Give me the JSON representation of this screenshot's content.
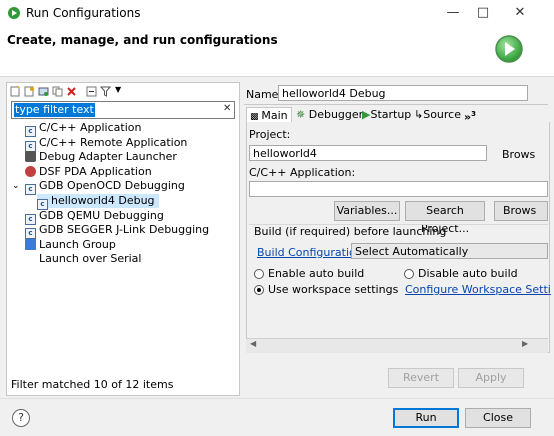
{
  "window": {
    "title": "Run Configurations"
  },
  "header": {
    "title": "Create, manage, and run configurations"
  },
  "left": {
    "filter": {
      "value": "type filter text"
    },
    "tree": [
      {
        "label": "C/C++ Application",
        "icon": "c-config-icon"
      },
      {
        "label": "C/C++ Remote Application",
        "icon": "c-config-icon"
      },
      {
        "label": "Debug Adapter Launcher",
        "icon": "debug-adapter-icon"
      },
      {
        "label": "DSF PDA Application",
        "icon": "pda-icon"
      },
      {
        "label": "GDB OpenOCD Debugging",
        "icon": "c-config-icon"
      },
      {
        "label": "helloworld4 Debug",
        "icon": "c-config-icon"
      },
      {
        "label": "GDB QEMU Debugging",
        "icon": "c-config-icon"
      },
      {
        "label": "GDB SEGGER J-Link Debugging",
        "icon": "c-config-icon"
      },
      {
        "label": "Launch Group",
        "icon": "launch-group-icon"
      },
      {
        "label": "Launch over Serial",
        "icon": ""
      }
    ],
    "status": "Filter matched 10 of 12 items"
  },
  "right": {
    "name_label": "Name:",
    "name_value": "helloworld4 Debug",
    "tabs": [
      {
        "label": "Main"
      },
      {
        "label": "Debugger"
      },
      {
        "label": "Startup"
      },
      {
        "label": "Source"
      },
      {
        "label": "»",
        "count": "3"
      }
    ],
    "project_label": "Project:",
    "project_value": "helloworld4",
    "browse1": "Brows",
    "app_label": "C/C++ Application:",
    "app_value": "",
    "variables": "Variables...",
    "search_project": "Search Project...",
    "browse2": "Brows",
    "build_group": "Build (if required) before launching",
    "build_config_link": "Build Configuration:",
    "build_config_value": "Select Automatically",
    "enable_auto": "Enable auto build",
    "disable_auto": "Disable auto build",
    "use_workspace": "Use workspace settings",
    "configure_ws": "Configure Workspace Setti",
    "revert": "Revert",
    "apply": "Apply"
  },
  "footer": {
    "run": "Run",
    "close": "Close"
  }
}
